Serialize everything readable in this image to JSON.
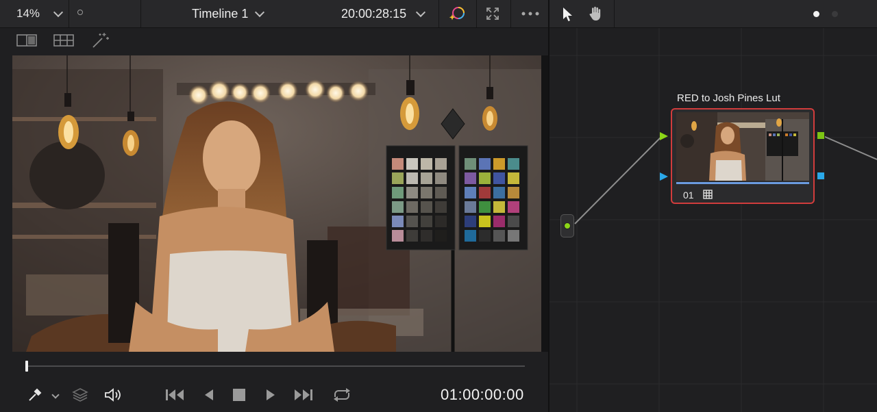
{
  "toolbar": {
    "zoom": "14%",
    "timeline_name": "Timeline 1",
    "timecode": "20:00:28:15"
  },
  "transport": {
    "timecode": "01:00:00:00"
  },
  "node_graph": {
    "node_label": "RED to  Josh Pines Lut",
    "node_number": "01"
  },
  "colors": {
    "node_border": "#d23c3c",
    "input_green": "#8cd617",
    "input_blue": "#2aa8e8",
    "output_green": "#7cc414",
    "output_blue": "#2aa8e8"
  }
}
